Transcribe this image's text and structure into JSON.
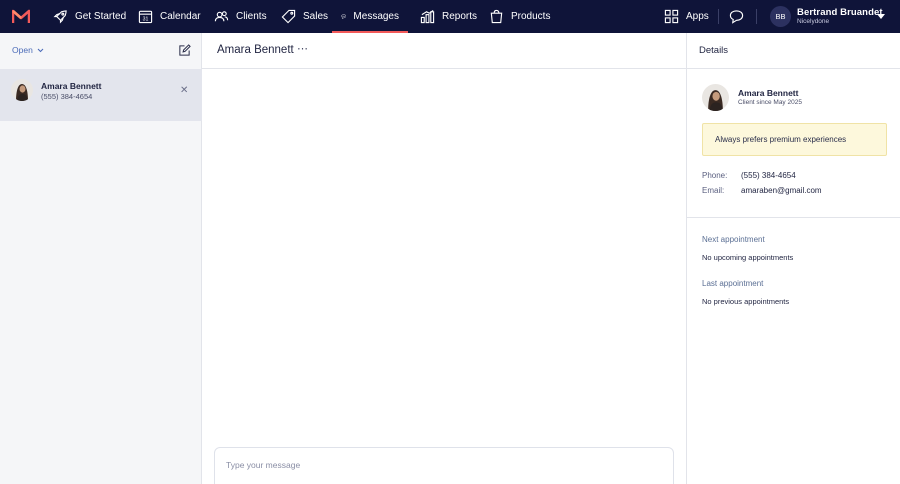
{
  "nav": {
    "items": [
      {
        "label": "Get Started",
        "icon": "rocket-icon"
      },
      {
        "label": "Calendar",
        "icon": "calendar-icon"
      },
      {
        "label": "Clients",
        "icon": "clients-icon"
      },
      {
        "label": "Sales",
        "icon": "tag-icon"
      },
      {
        "label": "Messages",
        "icon": "chat-icon",
        "active": true
      },
      {
        "label": "Reports",
        "icon": "chart-icon"
      },
      {
        "label": "Products",
        "icon": "bag-icon"
      }
    ],
    "calendar_day": "31",
    "apps_label": "Apps",
    "accent": "#f25a5a",
    "bg": "#0f1439"
  },
  "user": {
    "initials": "BB",
    "name": "Bertrand Bruandet",
    "company": "Nicelydone"
  },
  "inbox": {
    "filter_label": "Open",
    "conversations": [
      {
        "name": "Amara Bennett",
        "phone": "(555) 384-4654",
        "selected": true
      }
    ]
  },
  "conversation": {
    "title": "Amara Bennett",
    "more": "⋯",
    "composer_placeholder": "Type your message"
  },
  "details": {
    "header": "Details",
    "client_name": "Amara Bennett",
    "client_since": "Client since May 2025",
    "note": "Always prefers premium experiences",
    "phone_label": "Phone:",
    "phone": "(555) 384-4654",
    "email_label": "Email:",
    "email": "amaraben@gmail.com",
    "next_title": "Next appointment",
    "next_text": "No upcoming appointments",
    "last_title": "Last appointment",
    "last_text": "No previous appointments"
  }
}
